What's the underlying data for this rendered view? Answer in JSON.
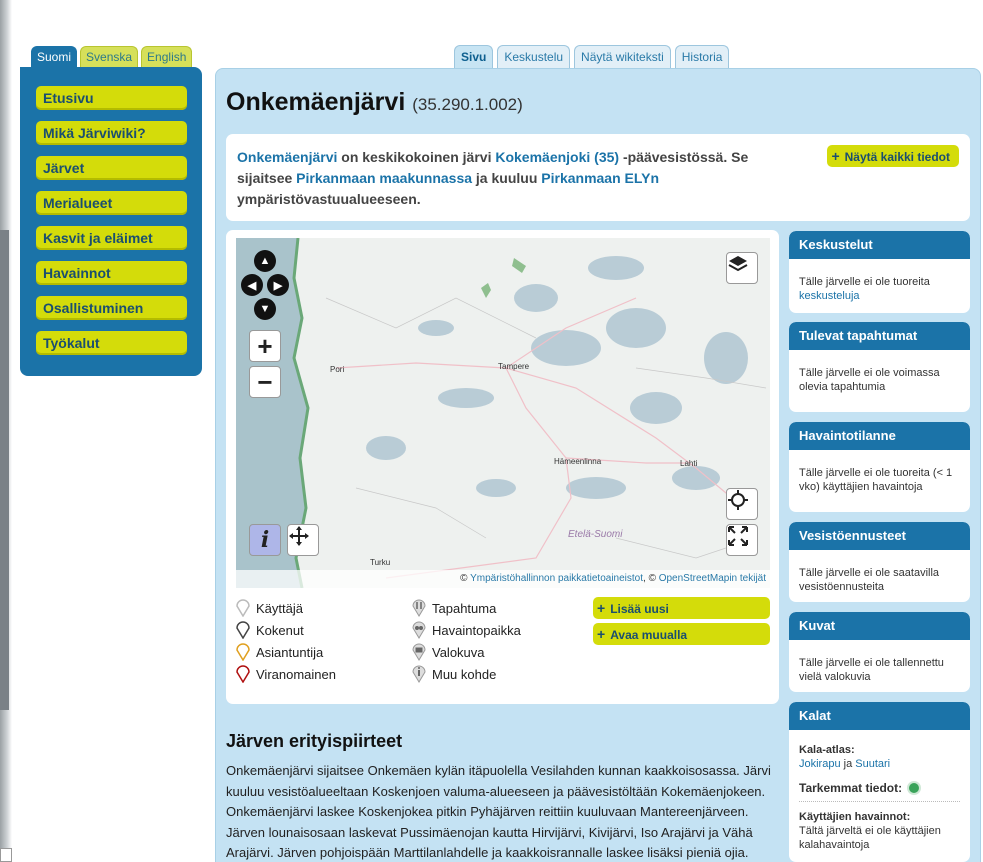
{
  "lang_tabs": [
    "Suomi",
    "Svenska",
    "English"
  ],
  "sidebar": {
    "items": [
      {
        "label": "Etusivu"
      },
      {
        "label": "Mikä Järviwiki?"
      },
      {
        "label": "Järvet"
      },
      {
        "label": "Merialueet"
      },
      {
        "label": "Kasvit ja eläimet"
      },
      {
        "label": "Havainnot"
      },
      {
        "label": "Osallistuminen"
      },
      {
        "label": "Työkalut"
      }
    ]
  },
  "main_tabs": [
    "Sivu",
    "Keskustelu",
    "Näytä wikiteksti",
    "Historia"
  ],
  "page": {
    "title": "Onkemäenjärvi",
    "code": "(35.290.1.002)"
  },
  "info": {
    "lake": "Onkemäenjärvi",
    "t1": " on keskikokoinen järvi ",
    "basin": "Kokemäenjoki (35)",
    "t2": " -päävesistössä. Se sijaitsee ",
    "region": "Pirkanmaan maakunnassa",
    "t3": " ja kuuluu ",
    "ely": "Pirkanmaan ELYn",
    "t4": " ympäristövastuualueeseen.",
    "show_all": "Näytä kaikki tiedot"
  },
  "map": {
    "places": [
      "Pori",
      "Tampere",
      "Hämeenlinna",
      "Lahti",
      "Turku",
      "Etelä-Suomi"
    ],
    "attribution_prefix": "© ",
    "attribution_link1": "Ympäristöhallinnon paikkatietoaineistot",
    "attribution_mid": ", © ",
    "attribution_link2": "OpenStreetMapin tekijät"
  },
  "legend": {
    "users": [
      "Käyttäjä",
      "Kokenut",
      "Asiantuntija",
      "Viranomainen"
    ],
    "types": [
      "Tapahtuma",
      "Havaintopaikka",
      "Valokuva",
      "Muu kohde"
    ],
    "pin_colors": [
      "#bbbbbb",
      "#444444",
      "#e0a020",
      "#b01010"
    ]
  },
  "actions": {
    "add": "Lisää uusi",
    "open": "Avaa muualla"
  },
  "right": {
    "discussions": {
      "title": "Keskustelut",
      "text": "Tälle järvelle ei ole tuoreita ",
      "link": "keskusteluja"
    },
    "events": {
      "title": "Tulevat tapahtumat",
      "text": "Tälle järvelle ei ole voimassa olevia tapahtumia"
    },
    "obs": {
      "title": "Havaintotilanne",
      "text": "Tälle järvelle ei ole tuoreita (< 1 vko) käyttäjien havaintoja"
    },
    "forecast": {
      "title": "Vesistöennusteet",
      "text": "Tälle järvelle ei ole saatavilla vesistöennusteita"
    },
    "photos": {
      "title": "Kuvat",
      "text": "Tälle järvelle ei ole tallennettu vielä valokuvia"
    },
    "fish": {
      "title": "Kalat",
      "atlas_label": "Kala-atlas:",
      "fish1": "Jokirapu",
      "and": " ja ",
      "fish2": "Suutari",
      "details_label": "Tarkemmat tiedot:",
      "user_obs_label": "Käyttäjien havainnot:",
      "user_obs_text": "Tältä järveltä ei ole käyttäjien kalahavaintoja"
    }
  },
  "section": {
    "title": "Järven erityispiirteet",
    "text": "Onkemäenjärvi sijaitsee Onkemäen kylän itäpuolella Vesilahden kunnan kaakkoisosassa. Järvi kuuluu vesistöalueeltaan Koskenjoen valuma-alueeseen ja päävesistöltään Kokemäenjokeen. Onkemäenjärvi laskee Koskenjokea pitkin Pyhäjärven reittiin kuuluvaan Mantereenjärveen. Järven lounaisosaan laskevat Pussimäenojan kautta Hirvijärvi, Kivijärvi, Iso Arajärvi ja Vähä Arajärvi. Järven pohjoispään Marttilanlahdelle ja kaakkoisrannalle laskee lisäksi pieniä ojia."
  }
}
